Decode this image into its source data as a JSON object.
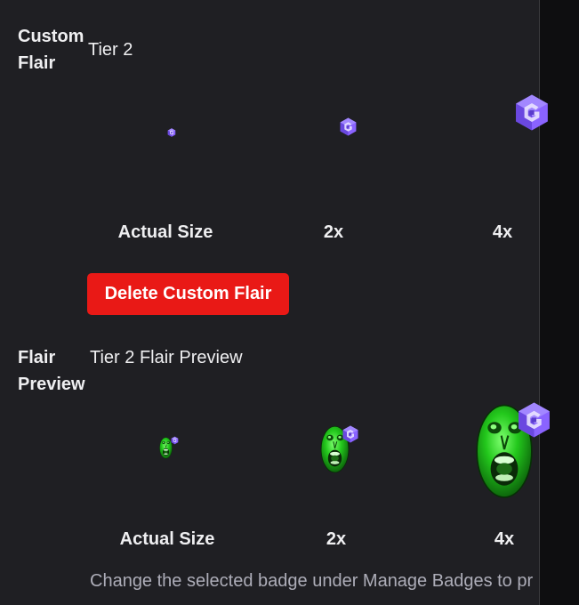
{
  "custom_flair": {
    "label": "Custom Flair",
    "tier": "Tier 2",
    "badge_icon": "gamecube-logo-icon",
    "sizes": [
      {
        "label": "Actual Size"
      },
      {
        "label": "2x"
      },
      {
        "label": "4x"
      }
    ],
    "delete_label": "Delete Custom Flair"
  },
  "flair_preview": {
    "label": "Flair Preview",
    "title": "Tier 2 Flair Preview",
    "emote_icon": "green-screaming-face-emote-icon",
    "sizes": [
      {
        "label": "Actual Size"
      },
      {
        "label": "2x"
      },
      {
        "label": "4x"
      }
    ]
  },
  "helper_text": "Change the selected badge under Manage Badges to pr",
  "colors": {
    "background": "#1f1f23",
    "side_panel": "#0e0e10",
    "badge_purple": "#7b5cff",
    "delete_red": "#e91916",
    "emote_green": "#25c41f",
    "muted_text": "#adadb8"
  }
}
